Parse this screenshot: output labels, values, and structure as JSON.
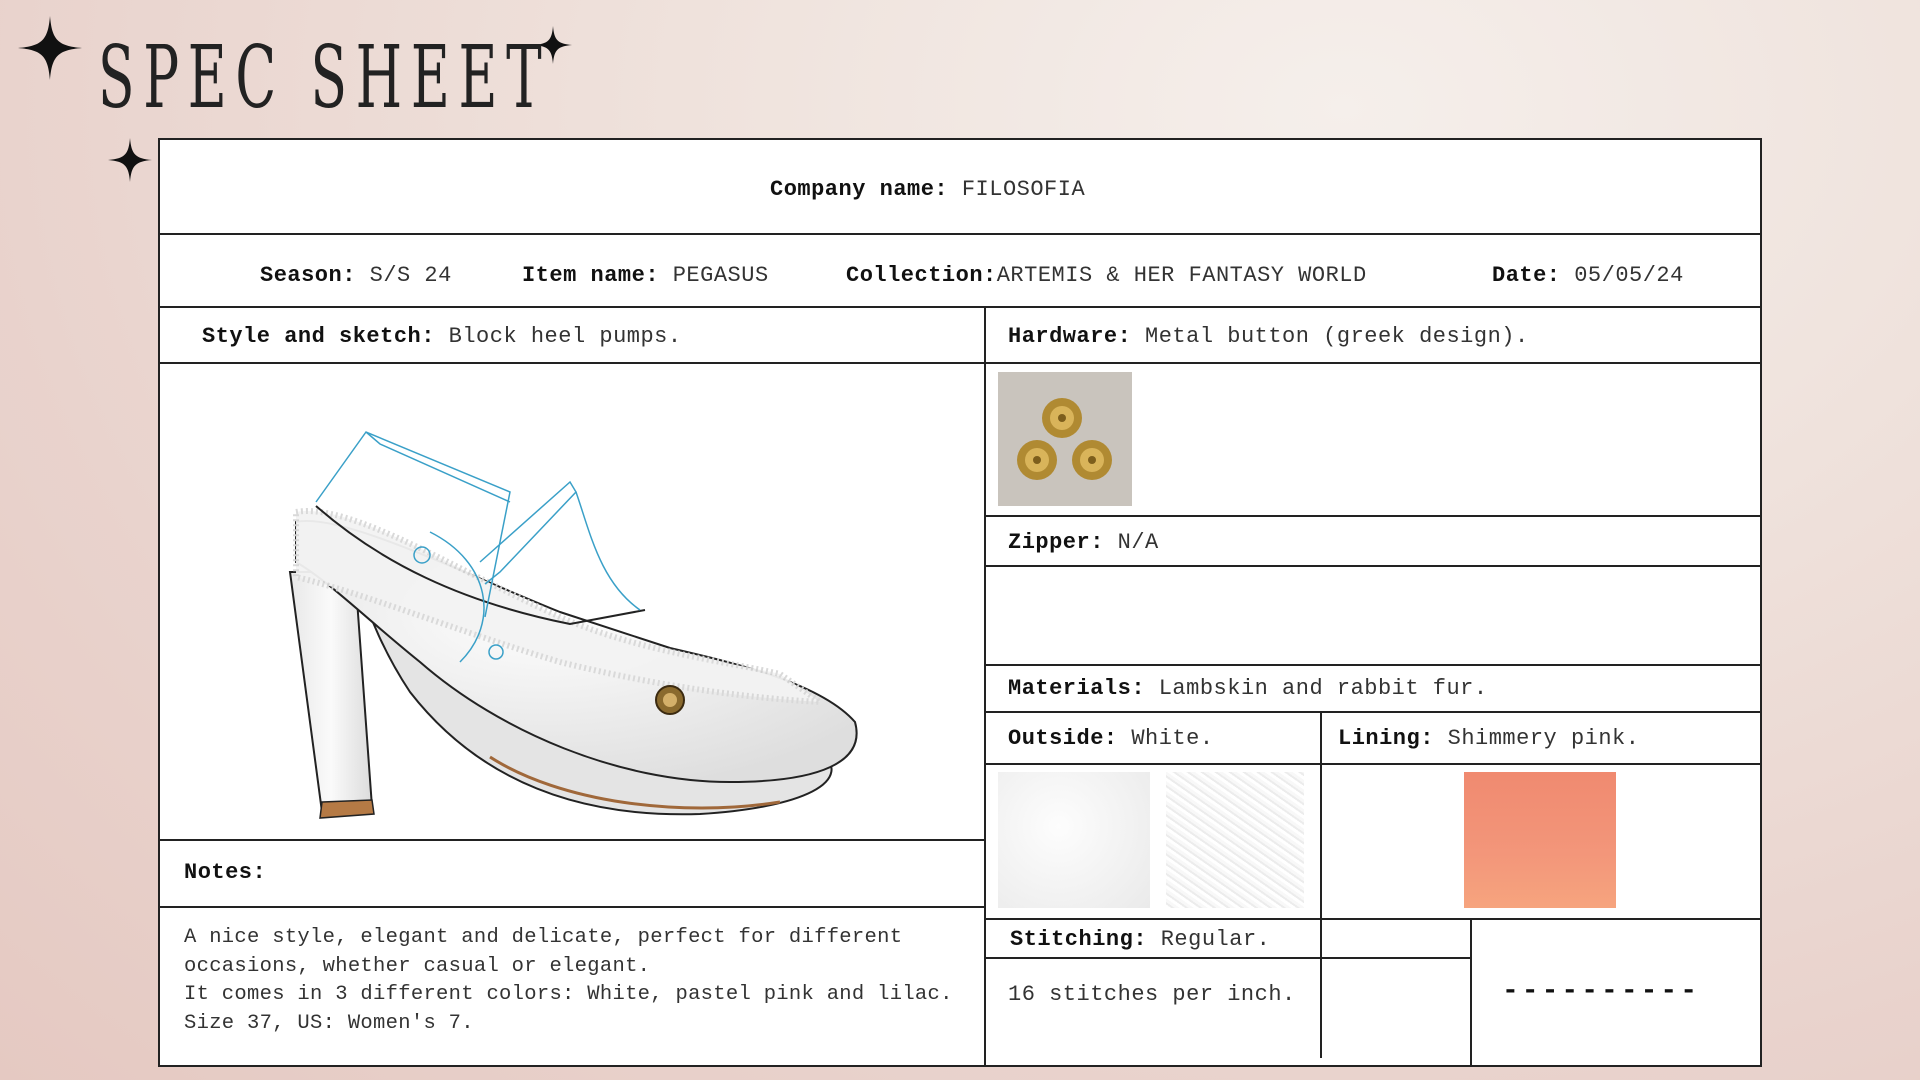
{
  "page": {
    "title": "SPEC SHEET"
  },
  "header": {
    "company_label": "Company name:",
    "company_value": "FILOSOFIA",
    "season_label": "Season:",
    "season_value": "S/S 24",
    "item_label": "Item name:",
    "item_value": "PEGASUS",
    "collection_label": "Collection:",
    "collection_value": "ARTEMIS & HER FANTASY WORLD",
    "date_label": "Date:",
    "date_value": "05/05/24"
  },
  "style": {
    "label": "Style and sketch:",
    "value": "Block heel pumps."
  },
  "hardware": {
    "label": "Hardware:",
    "value": "Metal button (greek design)."
  },
  "zipper": {
    "label": "Zipper:",
    "value": "N/A"
  },
  "materials": {
    "label": "Materials:",
    "value": "Lambskin and rabbit fur."
  },
  "outside": {
    "label": "Outside:",
    "value": "White."
  },
  "lining": {
    "label": "Lining:",
    "value": "Shimmery pink."
  },
  "stitching": {
    "label": "Stitching:",
    "value": "Regular.",
    "detail": "16 stitches per inch.",
    "extra": "----------"
  },
  "notes": {
    "label": "Notes:",
    "text": "A nice style, elegant and delicate, perfect for different\noccasions, whether casual or elegant.\nIt comes in 3 different colors: White, pastel pink and lilac.\nSize 37, US: Women's 7."
  },
  "colors": {
    "lining_swatch_top": "#f08a70",
    "lining_swatch_bottom": "#f6a47e",
    "outline": "#222222",
    "sketch_blue": "#3aa0c8"
  }
}
